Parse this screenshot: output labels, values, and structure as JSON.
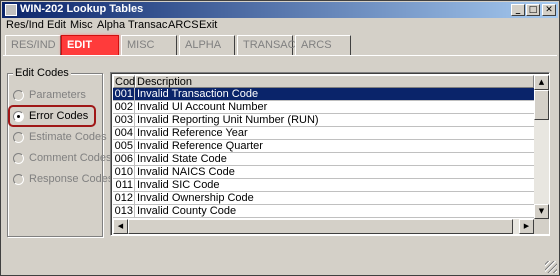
{
  "window": {
    "title": "WIN-202 Lookup Tables",
    "controls": {
      "minimize": "_",
      "maximize": "□",
      "close": "✕"
    }
  },
  "menu": [
    "Res/Ind",
    "Edit",
    "Misc",
    "Alpha",
    "Transac",
    "ARCS",
    "Exit"
  ],
  "tabs": [
    {
      "label": "RES/IND",
      "active": false
    },
    {
      "label": "EDIT",
      "active": true
    },
    {
      "label": "MISC",
      "active": false
    },
    {
      "label": "ALPHA",
      "active": false
    },
    {
      "label": "TRANSAC",
      "active": false
    },
    {
      "label": "ARCS",
      "active": false
    }
  ],
  "edit_codes": {
    "group_label": "Edit Codes",
    "options": [
      {
        "label": "Parameters",
        "selected": false
      },
      {
        "label": "Error Codes",
        "selected": true
      },
      {
        "label": "Estimate Codes",
        "selected": false
      },
      {
        "label": "Comment Codes",
        "selected": false
      },
      {
        "label": "Response Codes",
        "selected": false
      }
    ]
  },
  "grid": {
    "headers": {
      "code": "Code",
      "description": "Description"
    },
    "rows": [
      {
        "code": "001",
        "description": "Invalid Transaction Code",
        "selected": true
      },
      {
        "code": "002",
        "description": "Invalid UI Account Number",
        "selected": false
      },
      {
        "code": "003",
        "description": "Invalid Reporting Unit Number (RUN)",
        "selected": false
      },
      {
        "code": "004",
        "description": "Invalid Reference Year",
        "selected": false
      },
      {
        "code": "005",
        "description": "Invalid Reference Quarter",
        "selected": false
      },
      {
        "code": "006",
        "description": "Invalid State Code",
        "selected": false
      },
      {
        "code": "010",
        "description": "Invalid NAICS Code",
        "selected": false
      },
      {
        "code": "011",
        "description": "Invalid SIC Code",
        "selected": false
      },
      {
        "code": "012",
        "description": "Invalid Ownership Code",
        "selected": false
      },
      {
        "code": "013",
        "description": "Invalid County Code",
        "selected": false
      }
    ]
  },
  "colors": {
    "title_bar": "#0a246a",
    "active_tab": "#ff3b3b",
    "selection": "#0a246a",
    "highlight_box": "#a01818"
  }
}
